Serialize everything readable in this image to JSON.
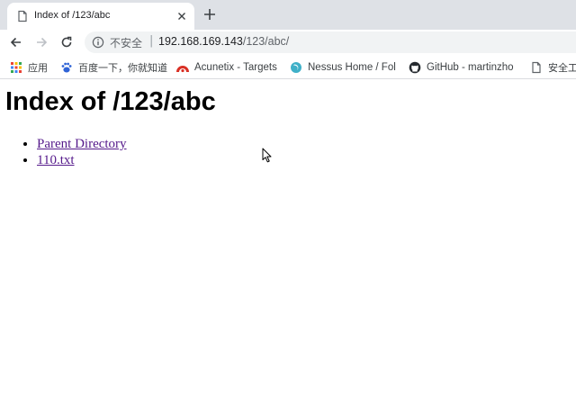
{
  "browser": {
    "tab": {
      "title": "Index of /123/abc",
      "icon": "document-icon"
    },
    "toolbar": {
      "security_label": "不安全",
      "url_host": "192.168.169.143",
      "url_path": "/123/abc/"
    },
    "bookmarks": [
      {
        "label": "应用",
        "icon": "apps-grid-icon"
      },
      {
        "label": "百度一下，你就知道",
        "icon": "baidu-paw-icon"
      },
      {
        "label": "Acunetix - Targets",
        "icon": "acunetix-icon"
      },
      {
        "label": "Nessus Home / Fol",
        "icon": "nessus-icon"
      },
      {
        "label": "GitHub - martinzho",
        "icon": "github-icon"
      },
      {
        "label": "安全工",
        "icon": "document-icon"
      }
    ]
  },
  "page": {
    "title": "Index of /123/abc",
    "entries": [
      {
        "label": "Parent Directory"
      },
      {
        "label": "110.txt"
      }
    ]
  },
  "colors": {
    "tabstrip": "#dee1e6",
    "link_visited": "#551a8b",
    "omnibox": "#f1f3f4"
  }
}
